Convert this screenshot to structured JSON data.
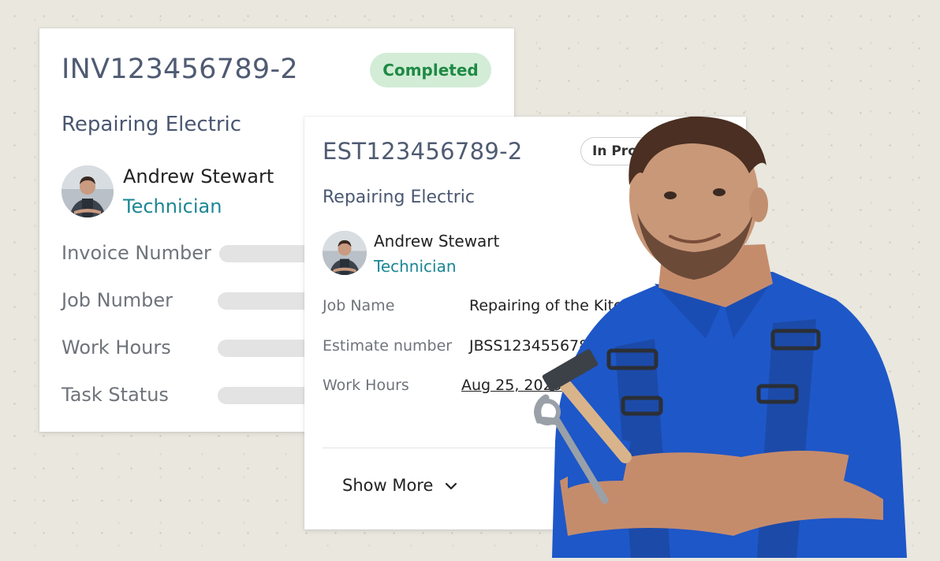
{
  "invoice_card": {
    "id": "INV123456789-2",
    "status": "Completed",
    "job_title": "Repairing Electric",
    "person": {
      "name": "Andrew Stewart",
      "role": "Technician"
    },
    "fields": [
      {
        "label": "Invoice Number"
      },
      {
        "label": "Job Number"
      },
      {
        "label": "Work Hours"
      },
      {
        "label": "Task Status"
      }
    ]
  },
  "estimate_card": {
    "id": "EST123456789-2",
    "status": "In Progress",
    "job_title": "Repairing Electric",
    "person": {
      "name": "Andrew Stewart",
      "role": "Technician"
    },
    "fields": [
      {
        "label": "Job Name",
        "value": "Repairing of the Kitchen"
      },
      {
        "label": "Estimate number",
        "value": "JBSS1234556789"
      },
      {
        "label": "Work Hours",
        "value": "Aug 25, 2025"
      }
    ],
    "show_more_label": "Show More"
  },
  "colors": {
    "badge_completed_bg": "#d3ecd6",
    "badge_completed_text": "#1f8a45",
    "role_text": "#1b8794",
    "shirt_blue": "#1e57c8"
  },
  "icons": [
    "chevron-down-icon",
    "technician-avatar",
    "technician-photo",
    "hammer-icon",
    "wrench-icon"
  ]
}
